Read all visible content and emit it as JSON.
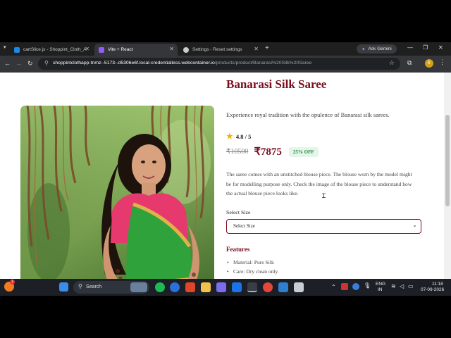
{
  "browser": {
    "tabs": [
      {
        "label": "cartSlice.js - Shoppint_Cloth_A",
        "favicon_color": "#1e88e5",
        "active": false
      },
      {
        "label": "Vite + React",
        "favicon_color": "#8e5cf7",
        "active": true
      },
      {
        "label": "Settings - Reset settings",
        "favicon_color": "#cccccc",
        "active": false
      }
    ],
    "new_tab_symbol": "+",
    "gemini_label": "Ask Gemini",
    "url_host": "shoppintclothapp-tnmz--5173--d5306e6f.local-credentialless.webcontainer.io",
    "url_path": "/products/product/Banarasi%20Silk%20Saree"
  },
  "product": {
    "title": "Banarasi Silk Saree",
    "tagline": "Experience royal tradition with the opulence of Banarasi silk sarees.",
    "rating": "4.8 / 5",
    "old_price": "₹10500",
    "new_price": "₹7875",
    "discount": "25% OFF",
    "description": "The saree comes with an unstitched blouse piece. The blouse worn by the model might be for modelling purpose only. Check the image of the blouse piece to understand how the actual blouse piece looks like.",
    "size_label": "Select Size",
    "size_selected": "Select Size",
    "features_title": "Features",
    "features": [
      "Material: Pure Silk",
      "Care: Dry clean only"
    ]
  },
  "taskbar": {
    "search_placeholder": "Search",
    "language": "ENG",
    "region": "IN",
    "time": "11:18",
    "date": "07-09-2026",
    "notification_count": "1"
  },
  "colors": {
    "accent": "#7a0d1e",
    "discount_bg": "#e4f6e9",
    "discount_text": "#1e8a3c",
    "rating_star": "#f0b400"
  }
}
